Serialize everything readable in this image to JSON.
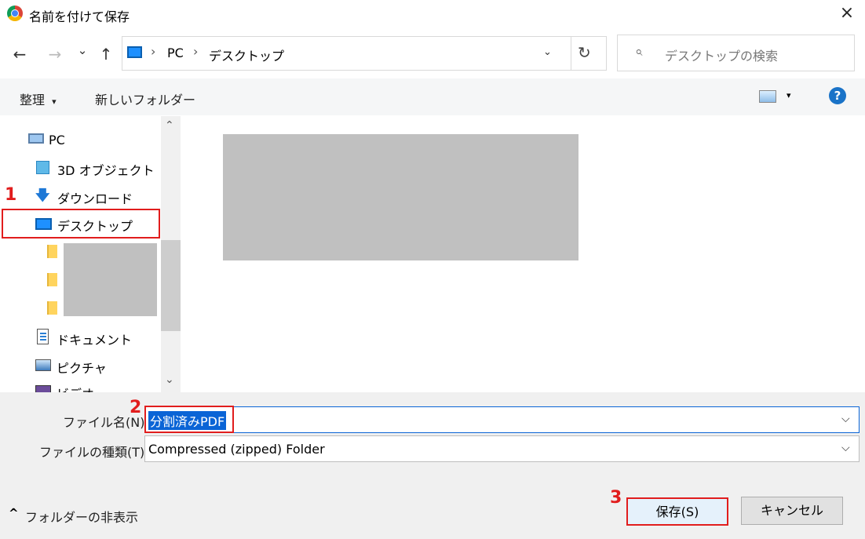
{
  "window": {
    "title": "名前を付けて保存",
    "close_icon": "×"
  },
  "nav_buttons": {
    "back": "←",
    "forward": "→",
    "recent": "⌄",
    "up": "↑"
  },
  "address": {
    "root": "PC",
    "folder": "デスクトップ",
    "separator": "›",
    "dropdown": "⌄",
    "refresh": "↻"
  },
  "search": {
    "placeholder": "デスクトップの検索",
    "icon": "⌕"
  },
  "toolbar": {
    "organize": "整理",
    "organize_caret": "▾",
    "new_folder": "新しいフォルダー",
    "view_caret": "▾",
    "help": "?"
  },
  "sidebar": {
    "scroll_up": "⌃",
    "scroll_down": "⌄",
    "items": [
      {
        "label": "PC",
        "icon": "pc-icon"
      },
      {
        "label": "3D オブジェクト",
        "icon": "cube-icon"
      },
      {
        "label": "ダウンロード",
        "icon": "download-icon"
      },
      {
        "label": "デスクトップ",
        "icon": "desktop-icon",
        "selected": true
      },
      {
        "label": "ドキュメント",
        "icon": "document-icon"
      },
      {
        "label": "ピクチャ",
        "icon": "picture-icon"
      },
      {
        "label": "ビデオ",
        "icon": "video-icon"
      }
    ],
    "download_glyph": "🡇"
  },
  "annotations": {
    "step1": "1",
    "step2": "2",
    "step3": "3"
  },
  "form": {
    "filename_label": "ファイル名(N):",
    "filename_value": "分割済みPDF",
    "filetype_label": "ファイルの種類(T):",
    "filetype_value": "Compressed (zipped) Folder",
    "dropdown_glyph": "⌵"
  },
  "footer": {
    "hide_folders": "フォルダーの非表示",
    "hide_caret": "^",
    "save": "保存(S)",
    "cancel": "キャンセル"
  },
  "colors": {
    "accent": "#0a64d6",
    "annotation_red": "#e11d1d"
  }
}
